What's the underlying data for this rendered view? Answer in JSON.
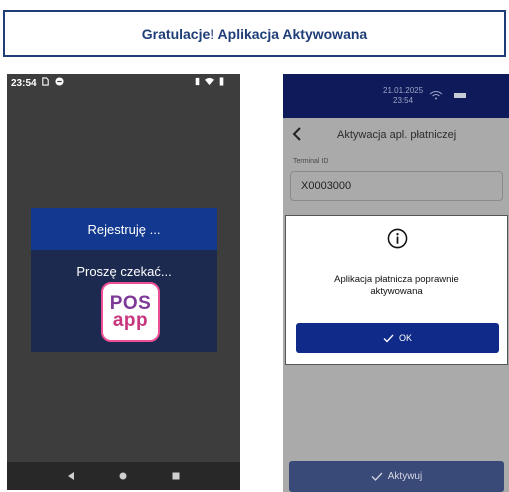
{
  "header": {
    "title_part1": "Gratulacje",
    "title_bang": "!",
    "title_part2": " Aplikacja Aktywowana"
  },
  "left_phone": {
    "status_time": "23:54",
    "dialog_title": "Rejestruję ...",
    "dialog_message": "Proszę czekać...",
    "logo": {
      "line1": "POS",
      "line2": "app"
    },
    "nav_icons": [
      "back-icon",
      "home-icon",
      "recents-icon"
    ]
  },
  "right_phone": {
    "status_date": "21.01.2025",
    "status_time": "23:54",
    "screen_title": "Aktywacja apl. płatniczej",
    "terminal_label": "Terminal ID",
    "terminal_value": "X0003000",
    "dialog_message": "Aplikacja płatnicza poprawnie aktywowana",
    "ok_label": "OK",
    "activate_label": "Aktywuj"
  },
  "colors": {
    "accent": "#1f3e78",
    "dialog_header": "#12388f",
    "ok_button": "#0f2a88",
    "logo_pink": "#ec4f96",
    "logo_purple": "#7d3a96"
  }
}
